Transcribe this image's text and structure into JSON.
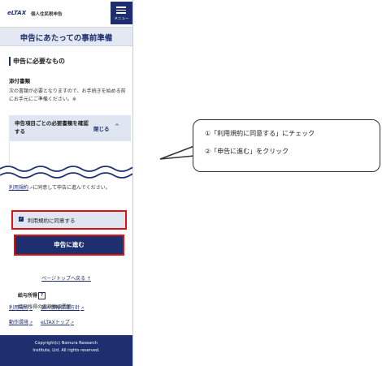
{
  "header": {
    "logo": "eLTAX",
    "logo_sub": "個人住民税申告",
    "menu_label": "メニュー"
  },
  "page_title": "申告にあたっての事前準備",
  "section": {
    "heading": "申告に必要なもの",
    "attachments_label": "添付書類",
    "attachments_text": "次の書類が必要となりますので、お手続きを始める前にお手元にご準備ください。※"
  },
  "accordion": {
    "title": "申告項目ごとの必要書類を確認する",
    "close_label": "閉じる",
    "items": [
      "給与所得",
      "給与所得の源泉徴収票等"
    ]
  },
  "agreement": {
    "link": "利用規約",
    "text": "に同意して申告に進んでください。",
    "checkbox_label": "利用規約に同意する",
    "checked": true
  },
  "proceed_button": "申告に進む",
  "page_top_link": "ページトップへ戻る",
  "footer": {
    "links": [
      "利用規約",
      "個人情報保護方針",
      "動作環境",
      "eLTAXトップ"
    ],
    "copyright_line1": "Copyright(c) Nomura Research",
    "copyright_line2": "Institute, Ltd. All rights reserved."
  },
  "callout": {
    "line1": "①「利用規約に同意する」にチェック",
    "line2": "②「申告に進む」をクリック"
  },
  "colors": {
    "brand": "#1d2f6f",
    "highlight": "#dd1111",
    "panel": "#dfe5f1"
  }
}
